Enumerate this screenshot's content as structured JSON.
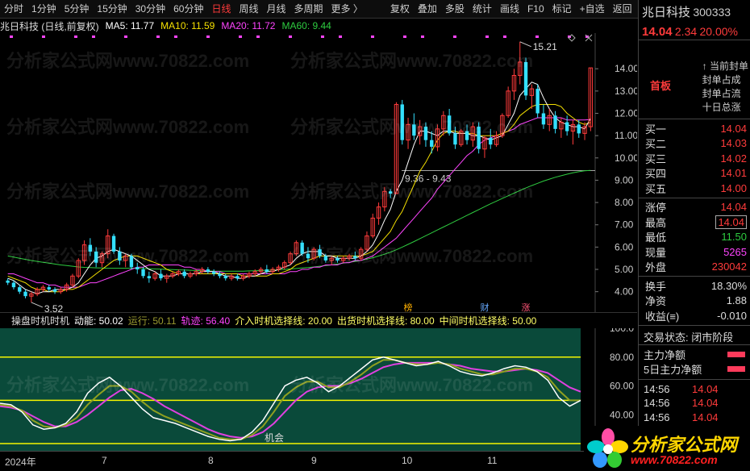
{
  "toolbar": {
    "items": [
      "分时",
      "1分钟",
      "5分钟",
      "15分钟",
      "30分钟",
      "60分钟",
      "日线",
      "周线",
      "月线",
      "多周期",
      "更多 〉"
    ],
    "active": 6,
    "tools": [
      "复权",
      "叠加",
      "多股",
      "统计",
      "画线",
      "F10",
      "标记",
      "+自选",
      "返回"
    ]
  },
  "info": {
    "name": "兆日科技 (日线,前复权)",
    "ma5": "MA5: 11.77",
    "ma10": "MA10: 11.59",
    "ma20": "MA20: 11.72",
    "ma60": "MA60: 9.44"
  },
  "colors": {
    "ma5": "#ffffff",
    "ma10": "#f5e000",
    "ma20": "#ff44ff",
    "ma60": "#2ecc40",
    "up": "#ff3b3b",
    "down": "#33e0ff"
  },
  "chart_data": {
    "type": "candlestick",
    "yticks": [
      4.0,
      5.0,
      6.0,
      7.0,
      8.0,
      9.0,
      10.0,
      11.0,
      12.0,
      13.0,
      14.0
    ],
    "ylim": [
      3.3,
      15.6
    ],
    "high_label": "15.21",
    "low_label": "3.52",
    "range_label": "9.36 - 9.43",
    "line_level": 9.43,
    "ohlc": [
      [
        4.5,
        4.6,
        4.3,
        4.4
      ],
      [
        4.4,
        4.5,
        4.1,
        4.2
      ],
      [
        4.2,
        4.3,
        3.9,
        4.0
      ],
      [
        4.0,
        4.1,
        3.7,
        3.8
      ],
      [
        3.8,
        4.0,
        3.52,
        3.9
      ],
      [
        3.9,
        4.2,
        3.8,
        4.1
      ],
      [
        4.1,
        4.3,
        4.0,
        4.2
      ],
      [
        4.2,
        4.3,
        4.0,
        4.1
      ],
      [
        4.1,
        4.2,
        3.9,
        4.0
      ],
      [
        4.0,
        4.2,
        3.9,
        4.1
      ],
      [
        4.1,
        4.4,
        4.0,
        4.3
      ],
      [
        4.3,
        4.8,
        4.2,
        4.7
      ],
      [
        4.7,
        5.5,
        4.6,
        5.4
      ],
      [
        5.4,
        6.3,
        5.2,
        6.1
      ],
      [
        6.1,
        6.4,
        5.6,
        5.8
      ],
      [
        5.8,
        6.0,
        5.1,
        5.3
      ],
      [
        5.3,
        5.8,
        5.1,
        5.7
      ],
      [
        5.7,
        6.8,
        5.5,
        6.5
      ],
      [
        6.5,
        6.6,
        5.7,
        5.8
      ],
      [
        5.8,
        6.0,
        5.2,
        5.4
      ],
      [
        5.4,
        5.7,
        5.1,
        5.6
      ],
      [
        5.6,
        5.7,
        5.0,
        5.1
      ],
      [
        5.1,
        5.3,
        4.8,
        5.0
      ],
      [
        5.0,
        5.1,
        4.6,
        4.7
      ],
      [
        4.7,
        4.9,
        4.4,
        4.6
      ],
      [
        4.6,
        4.9,
        4.5,
        4.8
      ],
      [
        4.8,
        5.0,
        4.5,
        4.6
      ],
      [
        4.6,
        4.8,
        4.4,
        4.7
      ],
      [
        4.7,
        4.9,
        4.6,
        4.8
      ],
      [
        4.8,
        5.0,
        4.7,
        4.9
      ],
      [
        4.9,
        5.0,
        4.6,
        4.7
      ],
      [
        4.7,
        4.9,
        4.6,
        4.8
      ],
      [
        4.8,
        5.0,
        4.7,
        4.9
      ],
      [
        4.9,
        5.1,
        4.8,
        5.0
      ],
      [
        5.0,
        5.1,
        4.8,
        4.9
      ],
      [
        4.9,
        5.0,
        4.7,
        4.8
      ],
      [
        4.8,
        4.9,
        4.6,
        4.7
      ],
      [
        4.7,
        4.8,
        4.5,
        4.6
      ],
      [
        4.6,
        4.8,
        4.5,
        4.7
      ],
      [
        4.7,
        4.8,
        4.5,
        4.6
      ],
      [
        4.6,
        4.8,
        4.5,
        4.7
      ],
      [
        4.7,
        4.9,
        4.6,
        4.8
      ],
      [
        4.8,
        5.0,
        4.7,
        4.9
      ],
      [
        4.9,
        5.1,
        4.8,
        5.0
      ],
      [
        5.0,
        5.2,
        4.8,
        4.9
      ],
      [
        4.9,
        5.1,
        4.8,
        5.0
      ],
      [
        5.0,
        5.2,
        4.9,
        5.1
      ],
      [
        5.1,
        5.4,
        5.0,
        5.3
      ],
      [
        5.3,
        5.8,
        5.2,
        5.7
      ],
      [
        5.7,
        6.3,
        5.6,
        6.2
      ],
      [
        6.2,
        6.3,
        5.6,
        5.7
      ],
      [
        5.7,
        6.0,
        5.3,
        5.5
      ],
      [
        5.5,
        6.0,
        5.4,
        5.9
      ],
      [
        5.9,
        6.1,
        5.5,
        5.6
      ],
      [
        5.6,
        5.7,
        5.3,
        5.4
      ],
      [
        5.4,
        5.6,
        5.2,
        5.5
      ],
      [
        5.5,
        5.6,
        5.3,
        5.4
      ],
      [
        5.4,
        5.6,
        5.3,
        5.5
      ],
      [
        5.5,
        5.7,
        5.4,
        5.6
      ],
      [
        5.6,
        5.8,
        5.4,
        5.5
      ],
      [
        5.5,
        6.0,
        5.4,
        5.9
      ],
      [
        5.9,
        6.7,
        5.8,
        6.5
      ],
      [
        6.5,
        7.5,
        6.4,
        7.3
      ],
      [
        7.3,
        8.0,
        7.0,
        7.8
      ],
      [
        7.8,
        8.7,
        7.6,
        8.5
      ],
      [
        8.5,
        8.6,
        8.2,
        8.4
      ],
      [
        8.4,
        12.5,
        8.4,
        12.4
      ],
      [
        12.4,
        12.6,
        10.6,
        10.8
      ],
      [
        10.8,
        11.8,
        10.4,
        11.5
      ],
      [
        11.5,
        12.0,
        10.8,
        11.0
      ],
      [
        11.0,
        11.7,
        10.6,
        11.4
      ],
      [
        11.4,
        11.6,
        10.5,
        10.8
      ],
      [
        10.8,
        11.2,
        10.2,
        10.5
      ],
      [
        10.5,
        11.5,
        10.3,
        11.3
      ],
      [
        11.3,
        12.1,
        11.0,
        11.9
      ],
      [
        11.9,
        12.2,
        11.0,
        11.1
      ],
      [
        11.1,
        11.4,
        10.4,
        10.6
      ],
      [
        10.6,
        11.3,
        10.5,
        11.2
      ],
      [
        11.2,
        11.5,
        10.6,
        10.8
      ],
      [
        10.8,
        11.6,
        10.5,
        11.4
      ],
      [
        11.4,
        11.6,
        10.2,
        10.4
      ],
      [
        10.4,
        11.0,
        10.0,
        10.9
      ],
      [
        10.9,
        11.3,
        10.4,
        10.6
      ],
      [
        10.6,
        11.2,
        10.5,
        11.0
      ],
      [
        11.0,
        12.0,
        10.9,
        11.9
      ],
      [
        11.9,
        13.2,
        11.8,
        13.0
      ],
      [
        13.0,
        14.0,
        12.6,
        13.7
      ],
      [
        13.7,
        15.21,
        13.3,
        14.3
      ],
      [
        14.3,
        14.5,
        12.6,
        12.8
      ],
      [
        12.8,
        13.3,
        12.2,
        13.1
      ],
      [
        13.1,
        13.3,
        11.8,
        12.0
      ],
      [
        12.0,
        12.4,
        11.3,
        11.5
      ],
      [
        11.5,
        12.2,
        11.2,
        11.9
      ],
      [
        11.9,
        12.1,
        11.1,
        11.3
      ],
      [
        11.3,
        11.8,
        10.9,
        11.6
      ],
      [
        11.6,
        11.9,
        11.0,
        11.2
      ],
      [
        11.2,
        11.7,
        10.6,
        11.5
      ],
      [
        11.5,
        11.7,
        10.9,
        11.1
      ],
      [
        11.1,
        11.6,
        10.8,
        11.4
      ],
      [
        11.4,
        14.04,
        11.2,
        14.04
      ]
    ],
    "ma5": [
      4.6,
      4.5,
      4.3,
      4.1,
      4.0,
      3.9,
      4.0,
      4.0,
      4.1,
      4.1,
      4.1,
      4.2,
      4.4,
      4.8,
      5.2,
      5.5,
      5.6,
      5.8,
      5.9,
      5.8,
      5.7,
      5.6,
      5.4,
      5.2,
      5.0,
      4.9,
      4.7,
      4.7,
      4.7,
      4.8,
      4.8,
      4.8,
      4.8,
      4.9,
      4.9,
      4.9,
      4.8,
      4.7,
      4.7,
      4.6,
      4.6,
      4.7,
      4.7,
      4.8,
      4.9,
      4.9,
      5.0,
      5.1,
      5.2,
      5.5,
      5.7,
      5.8,
      5.8,
      5.8,
      5.6,
      5.6,
      5.5,
      5.5,
      5.5,
      5.5,
      5.6,
      5.8,
      6.1,
      6.6,
      7.2,
      7.7,
      8.5,
      9.0,
      9.8,
      10.6,
      11.2,
      11.2,
      11.1,
      11.0,
      11.2,
      11.2,
      11.1,
      11.1,
      11.1,
      11.0,
      11.0,
      10.9,
      10.8,
      10.9,
      11.0,
      11.5,
      12.0,
      12.8,
      13.1,
      13.4,
      13.3,
      12.7,
      12.2,
      11.8,
      11.6,
      11.5,
      11.4,
      11.4,
      11.3,
      11.77
    ],
    "ma10": [
      4.7,
      4.6,
      4.5,
      4.4,
      4.2,
      4.1,
      4.1,
      4.0,
      4.0,
      4.0,
      4.1,
      4.1,
      4.2,
      4.4,
      4.6,
      4.8,
      5.0,
      5.2,
      5.4,
      5.5,
      5.6,
      5.6,
      5.6,
      5.5,
      5.4,
      5.3,
      5.2,
      5.0,
      4.9,
      4.8,
      4.8,
      4.8,
      4.8,
      4.8,
      4.8,
      4.8,
      4.8,
      4.8,
      4.8,
      4.8,
      4.7,
      4.7,
      4.7,
      4.7,
      4.7,
      4.8,
      4.8,
      4.9,
      5.0,
      5.2,
      5.3,
      5.4,
      5.5,
      5.6,
      5.6,
      5.6,
      5.6,
      5.6,
      5.6,
      5.6,
      5.6,
      5.7,
      5.8,
      6.1,
      6.4,
      6.7,
      7.2,
      7.6,
      8.2,
      8.8,
      9.4,
      9.8,
      10.3,
      10.8,
      11.1,
      11.2,
      11.2,
      11.1,
      11.1,
      11.1,
      11.0,
      11.0,
      11.0,
      11.0,
      11.1,
      11.2,
      11.5,
      11.9,
      12.1,
      12.3,
      12.4,
      12.4,
      12.4,
      12.4,
      12.3,
      12.0,
      11.8,
      11.6,
      11.5,
      11.59
    ],
    "ma20": [
      4.8,
      4.8,
      4.7,
      4.6,
      4.5,
      4.4,
      4.4,
      4.3,
      4.3,
      4.2,
      4.2,
      4.2,
      4.2,
      4.3,
      4.4,
      4.4,
      4.5,
      4.6,
      4.7,
      4.8,
      4.9,
      5.0,
      5.1,
      5.1,
      5.2,
      5.2,
      5.2,
      5.2,
      5.2,
      5.2,
      5.1,
      5.1,
      5.0,
      5.0,
      4.9,
      4.9,
      4.9,
      4.8,
      4.8,
      4.8,
      4.8,
      4.8,
      4.8,
      4.8,
      4.8,
      4.8,
      4.8,
      4.8,
      4.9,
      4.9,
      5.0,
      5.0,
      5.1,
      5.1,
      5.2,
      5.2,
      5.2,
      5.3,
      5.3,
      5.4,
      5.4,
      5.5,
      5.6,
      5.8,
      6.0,
      6.2,
      6.4,
      6.7,
      7.0,
      7.3,
      7.6,
      7.9,
      8.2,
      8.6,
      8.9,
      9.2,
      9.5,
      9.8,
      10.1,
      10.3,
      10.6,
      10.8,
      10.9,
      11.0,
      11.1,
      11.2,
      11.3,
      11.5,
      11.6,
      11.7,
      11.8,
      11.8,
      11.8,
      11.8,
      11.8,
      11.7,
      11.7,
      11.7,
      11.7,
      11.72
    ],
    "ma60": [
      5.6,
      5.55,
      5.5,
      5.45,
      5.4,
      5.36,
      5.32,
      5.28,
      5.24,
      5.2,
      5.17,
      5.14,
      5.11,
      5.09,
      5.08,
      5.07,
      5.06,
      5.05,
      5.05,
      5.05,
      5.05,
      5.05,
      5.05,
      5.04,
      5.03,
      5.02,
      5.01,
      5.0,
      4.99,
      4.98,
      4.97,
      4.96,
      4.95,
      4.94,
      4.93,
      4.92,
      4.92,
      4.92,
      4.92,
      4.92,
      4.92,
      4.93,
      4.94,
      4.95,
      4.96,
      4.97,
      4.98,
      5.0,
      5.02,
      5.04,
      5.06,
      5.08,
      5.11,
      5.14,
      5.17,
      5.2,
      5.24,
      5.28,
      5.32,
      5.36,
      5.4,
      5.46,
      5.52,
      5.6,
      5.68,
      5.77,
      5.88,
      6.0,
      6.12,
      6.25,
      6.38,
      6.51,
      6.64,
      6.77,
      6.9,
      7.03,
      7.16,
      7.29,
      7.42,
      7.55,
      7.68,
      7.81,
      7.94,
      8.06,
      8.18,
      8.3,
      8.42,
      8.54,
      8.65,
      8.76,
      8.86,
      8.96,
      9.05,
      9.13,
      9.2,
      9.27,
      9.33,
      9.38,
      9.42,
      9.44
    ]
  },
  "indicator": {
    "title": "操盘时机时机",
    "dongneng": "动能: 50.02",
    "yunxing": "运行: 50.11",
    "guiji": "轨迹: 56.40",
    "entry": "介入时机选择线: 20.00",
    "exit": "出货时机选择线: 80.00",
    "mid": "中间时机选择线: 50.00",
    "yticks": [
      "100.0",
      "80.00",
      "60.00",
      "40.00",
      "20.00"
    ],
    "ylim": [
      15,
      100
    ],
    "label_chance": "机会",
    "tags": [
      "榜",
      "财",
      "涨"
    ],
    "white": [
      48,
      47,
      42,
      33,
      30,
      31,
      34,
      42,
      55,
      62,
      66,
      60,
      52,
      44,
      38,
      36,
      34,
      31,
      28,
      25,
      23,
      22,
      23,
      28,
      36,
      48,
      60,
      64,
      66,
      62,
      56,
      60,
      66,
      72,
      78,
      80,
      78,
      76,
      74,
      75,
      77,
      74,
      70,
      68,
      67,
      69,
      72,
      74,
      73,
      70,
      64,
      52,
      46,
      50
    ],
    "green": [
      47,
      46,
      43,
      36,
      32,
      31,
      33,
      38,
      47,
      54,
      60,
      60,
      56,
      49,
      43,
      39,
      36,
      33,
      30,
      27,
      24,
      23,
      23,
      26,
      32,
      42,
      53,
      59,
      63,
      63,
      59,
      59,
      63,
      68,
      74,
      78,
      78,
      76,
      75,
      75,
      76,
      75,
      72,
      70,
      68,
      68,
      70,
      72,
      72,
      70,
      66,
      57,
      50,
      50
    ],
    "purple": [
      46,
      45,
      43,
      39,
      35,
      32,
      32,
      35,
      40,
      46,
      52,
      57,
      58,
      55,
      51,
      46,
      42,
      38,
      34,
      30,
      27,
      25,
      24,
      25,
      28,
      34,
      42,
      50,
      56,
      59,
      60,
      60,
      62,
      65,
      69,
      73,
      75,
      76,
      76,
      76,
      76,
      75,
      74,
      72,
      71,
      70,
      70,
      71,
      72,
      71,
      69,
      64,
      59,
      56
    ]
  },
  "dates": [
    "2024年",
    "7",
    "8",
    "9",
    "10",
    "11"
  ],
  "quote": {
    "name": "兆日科技",
    "code": "300333",
    "price": "14.04",
    "change": "2.34",
    "pct": "20.00%",
    "tag": "首板",
    "notes": [
      "当前封单",
      "封单占成",
      "封单占流",
      "十日总涨"
    ],
    "book": [
      {
        "k": "买一",
        "v": "14.04"
      },
      {
        "k": "买二",
        "v": "14.03"
      },
      {
        "k": "买三",
        "v": "14.02"
      },
      {
        "k": "买四",
        "v": "14.01"
      },
      {
        "k": "买五",
        "v": "14.00"
      }
    ],
    "stats": [
      {
        "k": "涨停",
        "v": "14.04",
        "c": "red"
      },
      {
        "k": "最高",
        "v": "14.04",
        "c": "red",
        "box": true
      },
      {
        "k": "最低",
        "v": "11.50",
        "c": "green"
      },
      {
        "k": "现量",
        "v": "5265",
        "c": "mag"
      },
      {
        "k": "外盘",
        "v": "230042",
        "c": "red"
      }
    ],
    "stats2": [
      {
        "k": "换手",
        "v": "18.30%",
        "c": "wht"
      },
      {
        "k": "净资",
        "v": "1.88",
        "c": "wht"
      },
      {
        "k": "收益(≡)",
        "v": "-0.010",
        "c": "wht"
      }
    ],
    "trade_status": "交易状态: 闭市阶段",
    "flow1": "主力净额",
    "flow2": "5日主力净额",
    "ticks": [
      {
        "t": "14:56",
        "p": "14.04"
      },
      {
        "t": "14:56",
        "p": "14.04"
      },
      {
        "t": "14:56",
        "p": "14.04"
      },
      {
        "t": "14:56",
        "p": "14.04"
      }
    ]
  },
  "logo": {
    "text": "分析家公式网",
    "url": "www.70822.com"
  },
  "watermark": "分析家公式网www.70822.com"
}
